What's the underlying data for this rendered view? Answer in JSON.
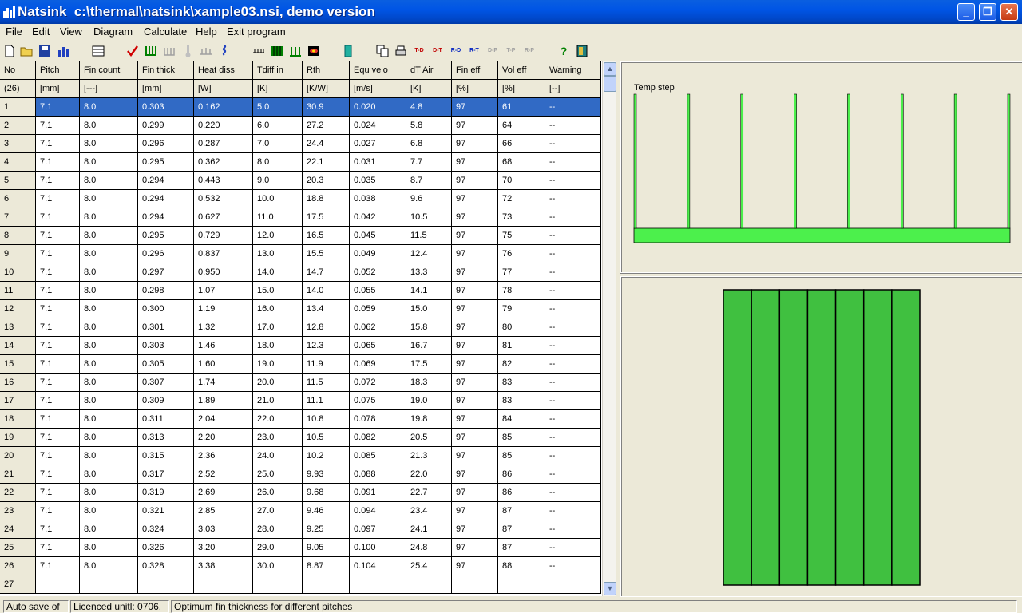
{
  "window": {
    "title": "Natsink  c:\\thermal\\natsink\\xample03.nsi, demo version",
    "minimize": "_",
    "maximize": "❐",
    "close": "✕"
  },
  "menu": [
    "File",
    "Edit",
    "View",
    "Diagram",
    "Calculate",
    "Help",
    "Exit program"
  ],
  "toolbar": {
    "icons": [
      "new-file-icon",
      "open-folder-icon",
      "save-icon",
      "chart-icon",
      "table-icon",
      "check-icon",
      "heatsink-icon",
      "heatsink-gray-icon",
      "thermometer-icon",
      "heatsink-flat-icon",
      "coil-icon",
      "fin-view-icon",
      "fin-array-icon",
      "fin-w-icon",
      "color-map-icon",
      "calculator-icon",
      "copy-icon",
      "print-icon"
    ],
    "diagram_labels": [
      "T-D",
      "D-T",
      "R-D",
      "R-T",
      "D-P",
      "T-P",
      "R-P"
    ],
    "help_icon": "?",
    "exit_icon": "exit-icon"
  },
  "table": {
    "columns": [
      "No",
      "Pitch",
      "Fin count",
      "Fin thick",
      "Heat diss",
      "Tdiff in",
      "Rth",
      "Equ velo",
      "dT Air",
      "Fin eff",
      "Vol eff",
      "Warning"
    ],
    "units": [
      "(26)",
      "[mm]",
      "[---]",
      "[mm]",
      "[W]",
      "[K]",
      "[K/W]",
      "[m/s]",
      "[K]",
      "[%]",
      "[%]",
      "[--]"
    ],
    "rows": [
      [
        "1",
        "7.1",
        "8.0",
        "0.303",
        "0.162",
        "5.0",
        "30.9",
        "0.020",
        "4.8",
        "97",
        "61",
        "--"
      ],
      [
        "2",
        "7.1",
        "8.0",
        "0.299",
        "0.220",
        "6.0",
        "27.2",
        "0.024",
        "5.8",
        "97",
        "64",
        "--"
      ],
      [
        "3",
        "7.1",
        "8.0",
        "0.296",
        "0.287",
        "7.0",
        "24.4",
        "0.027",
        "6.8",
        "97",
        "66",
        "--"
      ],
      [
        "4",
        "7.1",
        "8.0",
        "0.295",
        "0.362",
        "8.0",
        "22.1",
        "0.031",
        "7.7",
        "97",
        "68",
        "--"
      ],
      [
        "5",
        "7.1",
        "8.0",
        "0.294",
        "0.443",
        "9.0",
        "20.3",
        "0.035",
        "8.7",
        "97",
        "70",
        "--"
      ],
      [
        "6",
        "7.1",
        "8.0",
        "0.294",
        "0.532",
        "10.0",
        "18.8",
        "0.038",
        "9.6",
        "97",
        "72",
        "--"
      ],
      [
        "7",
        "7.1",
        "8.0",
        "0.294",
        "0.627",
        "11.0",
        "17.5",
        "0.042",
        "10.5",
        "97",
        "73",
        "--"
      ],
      [
        "8",
        "7.1",
        "8.0",
        "0.295",
        "0.729",
        "12.0",
        "16.5",
        "0.045",
        "11.5",
        "97",
        "75",
        "--"
      ],
      [
        "9",
        "7.1",
        "8.0",
        "0.296",
        "0.837",
        "13.0",
        "15.5",
        "0.049",
        "12.4",
        "97",
        "76",
        "--"
      ],
      [
        "10",
        "7.1",
        "8.0",
        "0.297",
        "0.950",
        "14.0",
        "14.7",
        "0.052",
        "13.3",
        "97",
        "77",
        "--"
      ],
      [
        "11",
        "7.1",
        "8.0",
        "0.298",
        "1.07",
        "15.0",
        "14.0",
        "0.055",
        "14.1",
        "97",
        "78",
        "--"
      ],
      [
        "12",
        "7.1",
        "8.0",
        "0.300",
        "1.19",
        "16.0",
        "13.4",
        "0.059",
        "15.0",
        "97",
        "79",
        "--"
      ],
      [
        "13",
        "7.1",
        "8.0",
        "0.301",
        "1.32",
        "17.0",
        "12.8",
        "0.062",
        "15.8",
        "97",
        "80",
        "--"
      ],
      [
        "14",
        "7.1",
        "8.0",
        "0.303",
        "1.46",
        "18.0",
        "12.3",
        "0.065",
        "16.7",
        "97",
        "81",
        "--"
      ],
      [
        "15",
        "7.1",
        "8.0",
        "0.305",
        "1.60",
        "19.0",
        "11.9",
        "0.069",
        "17.5",
        "97",
        "82",
        "--"
      ],
      [
        "16",
        "7.1",
        "8.0",
        "0.307",
        "1.74",
        "20.0",
        "11.5",
        "0.072",
        "18.3",
        "97",
        "83",
        "--"
      ],
      [
        "17",
        "7.1",
        "8.0",
        "0.309",
        "1.89",
        "21.0",
        "11.1",
        "0.075",
        "19.0",
        "97",
        "83",
        "--"
      ],
      [
        "18",
        "7.1",
        "8.0",
        "0.311",
        "2.04",
        "22.0",
        "10.8",
        "0.078",
        "19.8",
        "97",
        "84",
        "--"
      ],
      [
        "19",
        "7.1",
        "8.0",
        "0.313",
        "2.20",
        "23.0",
        "10.5",
        "0.082",
        "20.5",
        "97",
        "85",
        "--"
      ],
      [
        "20",
        "7.1",
        "8.0",
        "0.315",
        "2.36",
        "24.0",
        "10.2",
        "0.085",
        "21.3",
        "97",
        "85",
        "--"
      ],
      [
        "21",
        "7.1",
        "8.0",
        "0.317",
        "2.52",
        "25.0",
        "9.93",
        "0.088",
        "22.0",
        "97",
        "86",
        "--"
      ],
      [
        "22",
        "7.1",
        "8.0",
        "0.319",
        "2.69",
        "26.0",
        "9.68",
        "0.091",
        "22.7",
        "97",
        "86",
        "--"
      ],
      [
        "23",
        "7.1",
        "8.0",
        "0.321",
        "2.85",
        "27.0",
        "9.46",
        "0.094",
        "23.4",
        "97",
        "87",
        "--"
      ],
      [
        "24",
        "7.1",
        "8.0",
        "0.324",
        "3.03",
        "28.0",
        "9.25",
        "0.097",
        "24.1",
        "97",
        "87",
        "--"
      ],
      [
        "25",
        "7.1",
        "8.0",
        "0.326",
        "3.20",
        "29.0",
        "9.05",
        "0.100",
        "24.8",
        "97",
        "87",
        "--"
      ],
      [
        "26",
        "7.1",
        "8.0",
        "0.328",
        "3.38",
        "30.0",
        "8.87",
        "0.104",
        "25.4",
        "97",
        "88",
        "--"
      ],
      [
        "27",
        "",
        "",
        "",
        "",
        "",
        "",
        "",
        "",
        "",
        "",
        ""
      ]
    ],
    "selected_row": 0
  },
  "side_view": {
    "label": "Temp step",
    "fin_count": 8,
    "color": "#4cf04c"
  },
  "front_view": {
    "fin_count": 7,
    "color": "#40c040"
  },
  "statusbar": [
    "Auto save of",
    "Licenced unitl: 0706.",
    "Optimum fin thickness for different pitches"
  ]
}
